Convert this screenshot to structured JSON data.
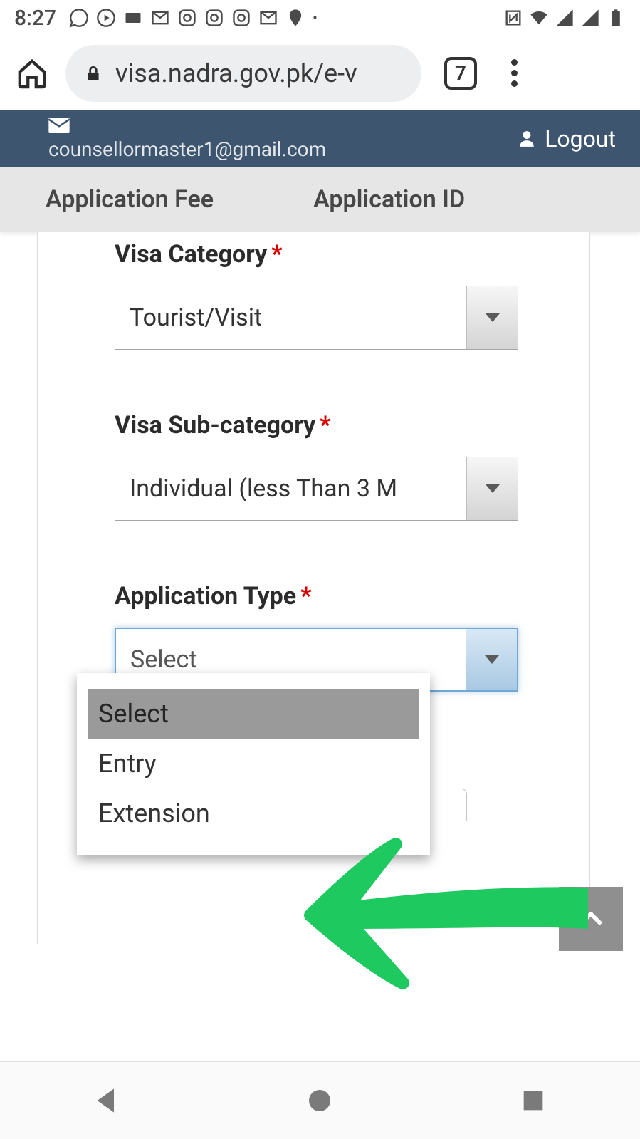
{
  "status": {
    "time": "8:27"
  },
  "browser": {
    "url": "visa.nadra.gov.pk/e-v",
    "tab_count": "7"
  },
  "header": {
    "email": "counsellormaster1@gmail.com",
    "logout": "Logout"
  },
  "tabs": {
    "fee": "Application Fee",
    "id": "Application ID"
  },
  "form": {
    "visa_category": {
      "label": "Visa Category",
      "value": "Tourist/Visit"
    },
    "visa_subcategory": {
      "label": "Visa Sub-category",
      "value": "Individual (less Than 3 M"
    },
    "application_type": {
      "label": "Application Type",
      "placeholder": "Select",
      "options": [
        "Select",
        "Entry",
        "Extension"
      ]
    }
  }
}
